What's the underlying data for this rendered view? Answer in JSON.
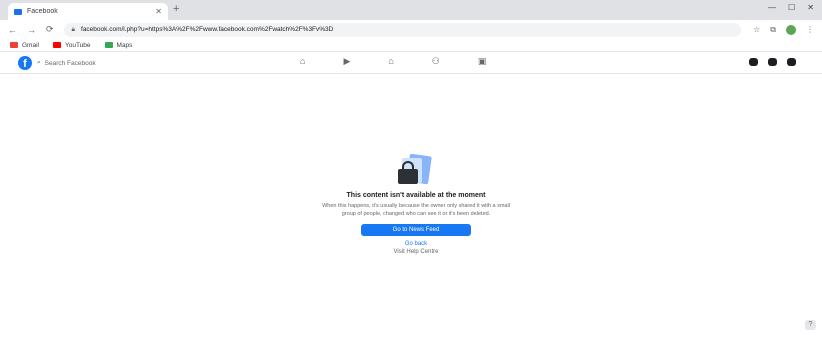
{
  "browser": {
    "tab_title": "Facebook",
    "new_tab_symbol": "+",
    "window_controls": [
      "—",
      "☐",
      "✕"
    ],
    "nav": {
      "back": "←",
      "forward": "→",
      "reload": "⟳"
    },
    "url": "facebook.com/l.php?u=https%3A%2F%2Fwww.facebook.com%2Fwatch%2F%3Fv%3D",
    "bookmarks": [
      {
        "label": "Gmail",
        "icon": "gmail-icon",
        "color": "#ea4335"
      },
      {
        "label": "YouTube",
        "icon": "youtube-icon",
        "color": "#ff0000"
      },
      {
        "label": "Maps",
        "icon": "maps-icon",
        "color": "#34a853"
      }
    ]
  },
  "fb": {
    "logo": "f",
    "search_placeholder": "Search Facebook",
    "nav_icons": [
      "home-icon",
      "watch-icon",
      "marketplace-icon",
      "groups-icon",
      "gaming-icon"
    ],
    "nav_glyphs": [
      "⌂",
      "▶",
      "⌂",
      "⚇",
      "▣"
    ]
  },
  "content": {
    "title": "This content isn't available at the moment",
    "description": "When this happens, it's usually because the owner only shared it with a small group of people, changed who can see it or it's been deleted.",
    "button": "Go to News Feed",
    "link_back": "Go back",
    "link_help": "Visit Help Centre"
  },
  "help_symbol": "?"
}
